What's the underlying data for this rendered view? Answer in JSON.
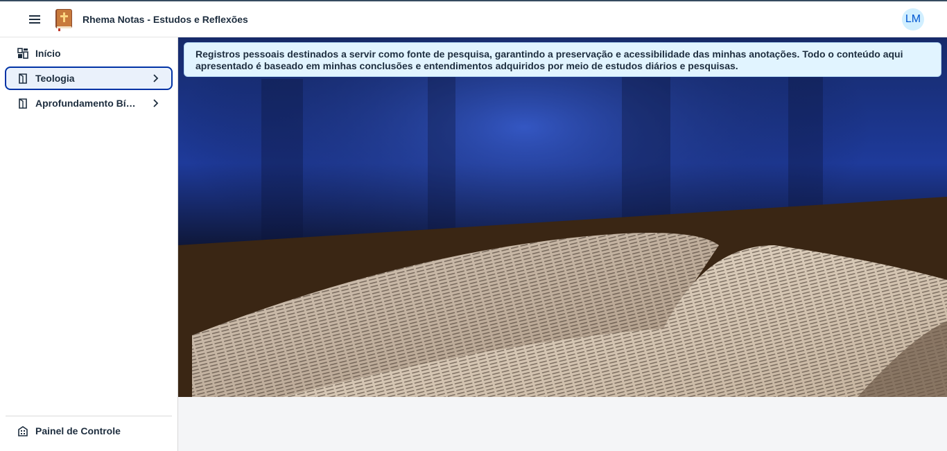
{
  "header": {
    "app_title": "Rhema Notas - Estudos e Reflexões",
    "user_initials": "LM"
  },
  "sidebar": {
    "items": [
      {
        "label": "Início",
        "icon": "dashboard-icon"
      },
      {
        "label": "Teologia",
        "icon": "book-icon",
        "selected": true
      },
      {
        "label": "Aprofundamento Bíblico",
        "icon": "book-icon"
      }
    ],
    "footer_item": {
      "label": "Painel de Controle",
      "icon": "building-icon"
    }
  },
  "main": {
    "info_text": "Registros pessoais destinados a servir como fonte de pesquisa, garantindo a preservação e acessibilidade das minhas anotações. Todo o conteúdo aqui apresentado é baseado em minhas conclusões e entendimentos adquiridos por meio de estudos diários e pesquisas."
  },
  "colors": {
    "accent": "#0032a5",
    "banner_bg": "#e1f4ff",
    "avatar_bg": "#d1efff"
  }
}
